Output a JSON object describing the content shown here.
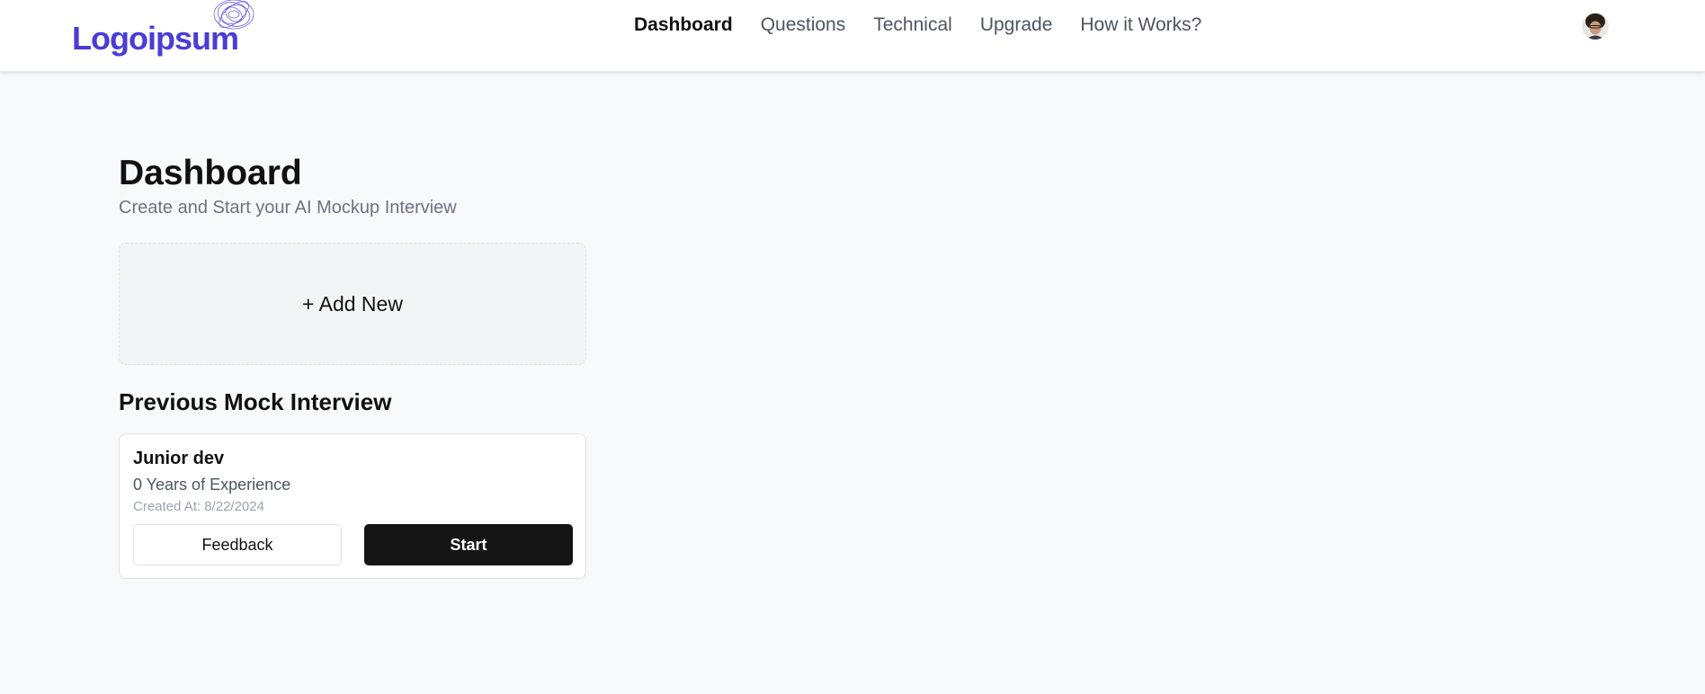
{
  "header": {
    "logo_text": "Logoipsum",
    "nav": [
      {
        "label": "Dashboard",
        "active": true
      },
      {
        "label": "Questions",
        "active": false
      },
      {
        "label": "Technical",
        "active": false
      },
      {
        "label": "Upgrade",
        "active": false
      },
      {
        "label": "How it Works?",
        "active": false
      }
    ],
    "avatar_icon": "user-avatar"
  },
  "main": {
    "title": "Dashboard",
    "subtitle": "Create and Start your AI Mockup Interview",
    "add_new_label": "+ Add New",
    "section_title": "Previous Mock Interview",
    "interviews": [
      {
        "role": "Junior dev",
        "experience": "0 Years of Experience",
        "created_at": "Created At: 8/22/2024",
        "feedback_label": "Feedback",
        "start_label": "Start"
      }
    ]
  },
  "colors": {
    "brand": "#4a3dd6",
    "background": "#f8f9fb",
    "primary_button": "#151515"
  }
}
